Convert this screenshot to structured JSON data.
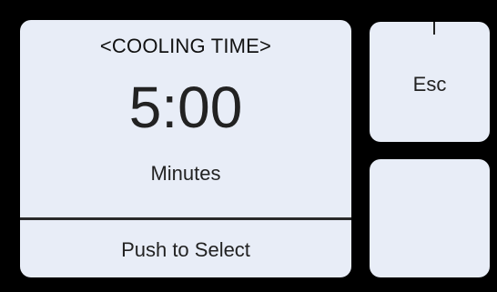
{
  "main_panel": {
    "title": "<COOLING TIME>",
    "value": "5:00",
    "unit": "Minutes",
    "action_label": "Push to Select"
  },
  "side_buttons": {
    "esc_label": "Esc",
    "blank_label": ""
  },
  "colors": {
    "background": "#000000",
    "panel": "#e8edf7",
    "text": "#222222"
  }
}
